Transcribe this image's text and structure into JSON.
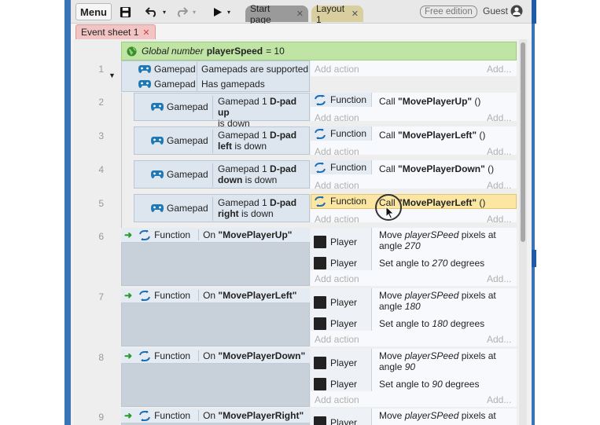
{
  "toolbar": {
    "menu_label": "Menu",
    "tabs": [
      {
        "label": "Start page"
      },
      {
        "label": "Layout 1"
      }
    ],
    "free_badge": "Free edition",
    "guest_label": "Guest"
  },
  "sheet_tab": {
    "label": "Event sheet 1"
  },
  "global_var": {
    "prefix": "Global number",
    "name": "playerSpeed",
    "value": "= 10"
  },
  "common": {
    "add_action": "Add action",
    "add_more": "Add...",
    "gamepad": "Gamepad",
    "function": "Function",
    "player": "Player"
  },
  "events": [
    {
      "num": "1",
      "conditions": [
        "Gamepads are supported",
        "Has gamepads"
      ]
    },
    {
      "num": "2",
      "cond_pre": "Gamepad 1 ",
      "cond_bold": "D-pad up",
      "cond_post": "is down",
      "call_pre": "Call ",
      "call_name": "\"MovePlayerUp\"",
      "call_post": " ()"
    },
    {
      "num": "3",
      "cond_pre": "Gamepad 1 ",
      "cond_bold1": "D-pad",
      "cond_bold2": "left",
      "cond_post": " is down",
      "call_pre": "Call ",
      "call_name": "\"MovePlayerLeft\"",
      "call_post": " ()"
    },
    {
      "num": "4",
      "cond_pre": "Gamepad 1 ",
      "cond_bold1": "D-pad",
      "cond_bold2": "down",
      "cond_post": " is down",
      "call_pre": "Call ",
      "call_name": "\"MovePlayerDown\"",
      "call_post": " ()"
    },
    {
      "num": "5",
      "cond_pre": "Gamepad 1 ",
      "cond_bold1": "D-pad",
      "cond_bold2": "right",
      "cond_post": " is down",
      "call_pre": "Call ",
      "call_name": "\"MovePlayerLeft\"",
      "call_post": " ()"
    },
    {
      "num": "6",
      "on_pre": "On ",
      "on_name": "\"MovePlayerUp\"",
      "move_pre": "Move ",
      "move_var": "playerSPeed",
      "move_mid": " pixels at",
      "move_angle_pre": "angle ",
      "move_angle": "270",
      "set_pre": "Set angle to ",
      "set_val": "270",
      "set_post": " degrees"
    },
    {
      "num": "7",
      "on_pre": "On ",
      "on_name": "\"MovePlayerLeft\"",
      "move_pre": "Move ",
      "move_var": "playerSPeed",
      "move_mid": " pixels at",
      "move_angle_pre": "angle ",
      "move_angle": "180",
      "set_pre": "Set angle to ",
      "set_val": "180",
      "set_post": " degrees"
    },
    {
      "num": "8",
      "on_pre": "On ",
      "on_name": "\"MovePlayerDown\"",
      "move_pre": "Move ",
      "move_var": "playerSPeed",
      "move_mid": " pixels at",
      "move_angle_pre": "angle ",
      "move_angle": "90",
      "set_pre": "Set angle to ",
      "set_val": "90",
      "set_post": " degrees"
    },
    {
      "num": "9",
      "on_pre": "On ",
      "on_name": "\"MovePlayerRight\"",
      "move_pre": "Move ",
      "move_var": "playerSPeed",
      "move_mid": " pixels at"
    }
  ]
}
